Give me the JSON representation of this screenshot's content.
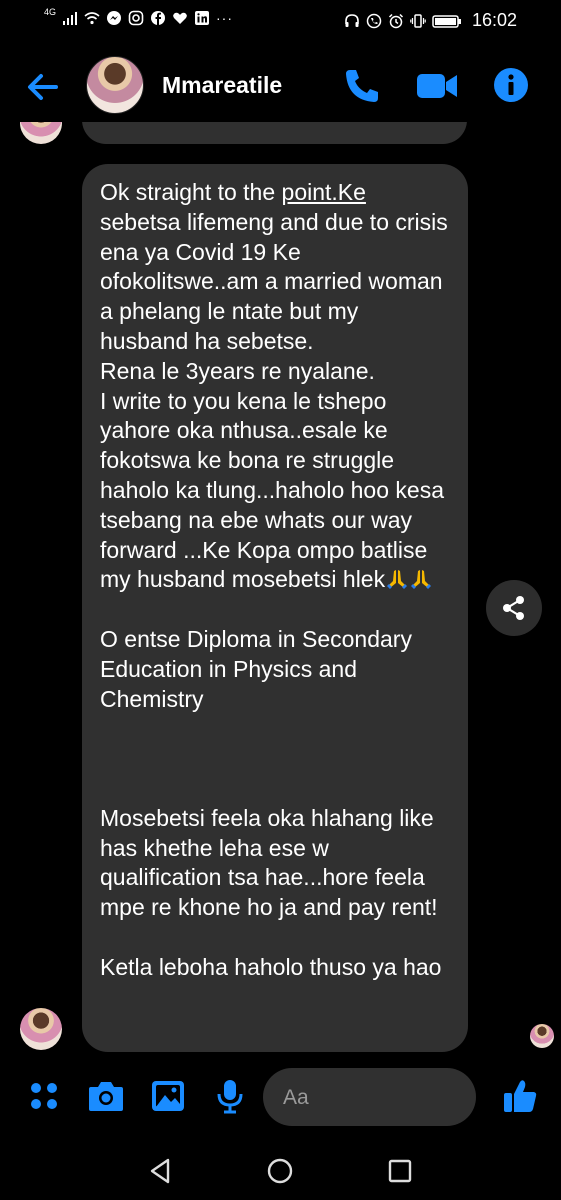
{
  "status_bar": {
    "network_label": "4G",
    "time": "16:02",
    "overflow": "···"
  },
  "header": {
    "contact_name": "Mmareatile"
  },
  "message": {
    "line_before_link": "Ok straight to the ",
    "link_text": "point.Ke",
    "body": " sebetsa lifemeng and due to crisis ena ya Covid 19 Ke ofokolitswe..am a married woman a phelang le ntate but my husband ha sebetse.\nRena le 3years re nyalane.\nI write to you kena le tshepo yahore oka nthusa..esale ke fokotswa ke bona re struggle haholo ka tlung...haholo hoo kesa tsebang na ebe whats our way forward ...Ke Kopa ompo batlise my husband mosebetsi hlek",
    "after_emoji": "\n\nO entse Diploma in Secondary Education in Physics and Chemistry\n\n\n\nMosebetsi feela oka hlahang like has khethe leha ese w qualification tsa hae...hore feela mpe re khone ho ja and pay rent!\n\nKetla leboha haholo thuso ya hao"
  },
  "composer": {
    "placeholder": "Aa"
  },
  "colors": {
    "accent": "#1a8cff",
    "bubble": "#303030",
    "background": "#000000"
  }
}
